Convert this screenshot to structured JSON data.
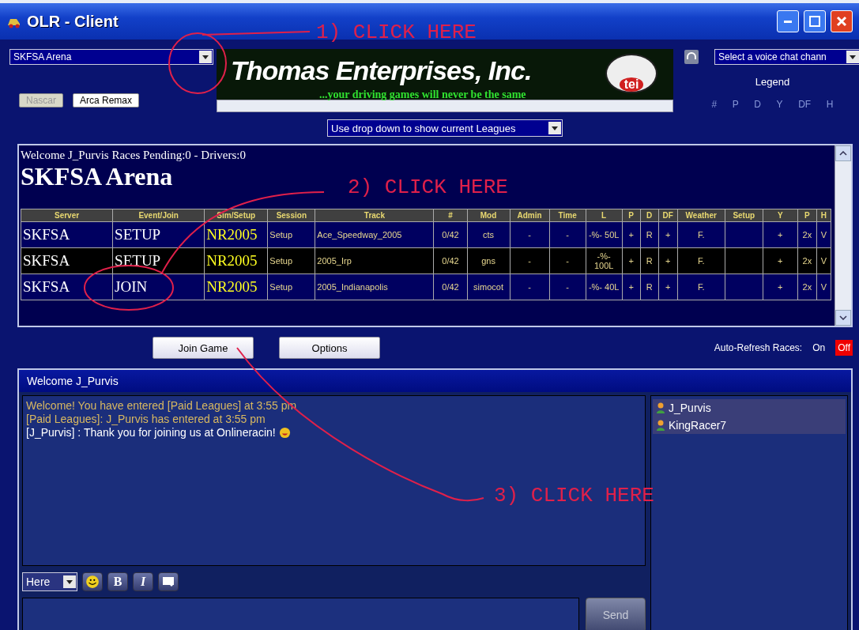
{
  "window": {
    "title": "OLR - Client"
  },
  "league_select": {
    "value": "SKFSA Arena"
  },
  "series_buttons": [
    {
      "label": "Nascar",
      "disabled": true
    },
    {
      "label": "Arca Remax",
      "disabled": false
    }
  ],
  "banner": {
    "title": "Thomas Enterprises, Inc.",
    "tagline": "...your driving games will never be the same",
    "logo": "tei"
  },
  "leagues_select": {
    "value": "Use drop down to show current Leagues"
  },
  "voice_select": {
    "value": "Select a voice chat chann"
  },
  "legend": {
    "title": "Legend",
    "keys": [
      "#",
      "P",
      "D",
      "Y",
      "DF",
      "H"
    ]
  },
  "races": {
    "welcome": "Welcome J_Purvis Races Pending:0 - Drivers:0",
    "heading": "SKFSA Arena",
    "columns": [
      "Server",
      "Event/Join",
      "Sim/Setup",
      "Session",
      "Track",
      "#",
      "Mod",
      "Admin",
      "Time",
      "L",
      "P",
      "D",
      "DF",
      "Weather",
      "Setup",
      "Y",
      "P",
      "H"
    ],
    "rows": [
      {
        "selected": false,
        "cells": [
          "SKFSA",
          "SETUP",
          "NR2005",
          "Setup",
          "Ace_Speedway_2005",
          "0/42",
          "cts",
          "-",
          "-",
          "-%- 50L",
          "+",
          "R",
          "+",
          "F.",
          "",
          "+",
          "2x",
          "V"
        ]
      },
      {
        "selected": true,
        "cells": [
          "SKFSA",
          "SETUP",
          "NR2005",
          "Setup",
          "2005_Irp",
          "0/42",
          "gns",
          "-",
          "-",
          "-%- 100L",
          "+",
          "R",
          "+",
          "F.",
          "",
          "+",
          "2x",
          "V"
        ]
      },
      {
        "selected": false,
        "cells": [
          "SKFSA",
          "JOIN",
          "NR2005",
          "Setup",
          "2005_Indianapolis",
          "0/42",
          "simocot",
          "-",
          "-",
          "-%- 40L",
          "+",
          "R",
          "+",
          "F.",
          "",
          "+",
          "2x",
          "V"
        ]
      }
    ]
  },
  "actions": [
    "Join Game",
    "Options"
  ],
  "auto_refresh": {
    "label": "Auto-Refresh Races:",
    "options": [
      {
        "label": "On",
        "selected": false
      },
      {
        "label": "Off",
        "selected": true
      }
    ]
  },
  "chat": {
    "title": "Welcome J_Purvis",
    "messages": [
      {
        "text": "Welcome! You have entered [Paid Leagues] at 3:55 pm",
        "color": "#d8b860"
      },
      {
        "text": "[Paid Leagues]: J_Purvis has entered at 3:55 pm",
        "color": "#d8b860"
      },
      {
        "text": "[J_Purvis] : Thank you for joining us at Onlineracin!",
        "color": "#ffffff"
      }
    ],
    "users": [
      "J_Purvis",
      "KingRacer7"
    ],
    "target_select": {
      "value": "Here"
    },
    "format_buttons": [
      "B",
      "I"
    ],
    "send": "Send"
  },
  "annotations": [
    "1) CLICK HERE",
    "2) CLICK HERE",
    "3) CLICK HERE"
  ]
}
